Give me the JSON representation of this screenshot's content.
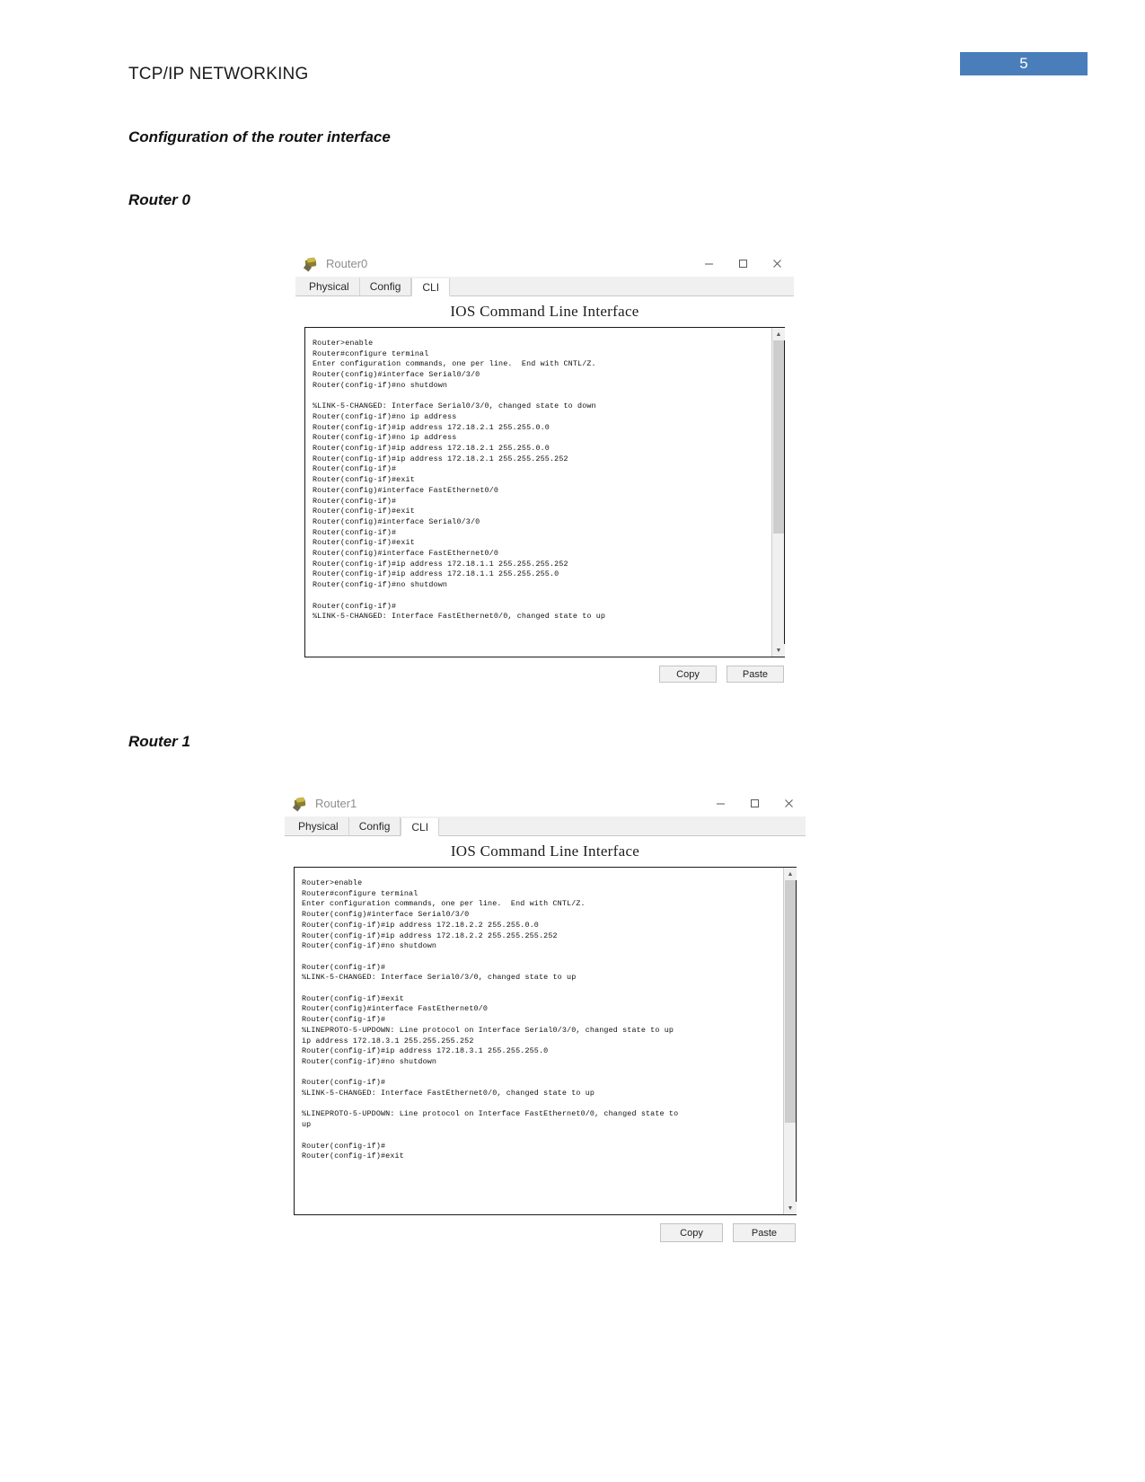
{
  "page": {
    "header_title": "TCP/IP NETWORKING",
    "page_number": "5",
    "badge_color": "#4A7EBB",
    "section_title": "Configuration of the router interface",
    "router0_label": "Router 0",
    "router1_label": "Router 1"
  },
  "window0": {
    "title": "Router0",
    "icon": "router-icon",
    "controls": {
      "minimize": "minimize-icon",
      "maximize": "maximize-icon",
      "close": "close-icon"
    },
    "tabs": [
      {
        "label": "Physical",
        "active": false
      },
      {
        "label": "Config",
        "active": false
      },
      {
        "label": "CLI",
        "active": true
      }
    ],
    "cli_heading": "IOS Command Line Interface",
    "terminal_text": "Router>enable\nRouter#configure terminal\nEnter configuration commands, one per line.  End with CNTL/Z.\nRouter(config)#interface Serial0/3/0\nRouter(config-if)#no shutdown\n\n%LINK-5-CHANGED: Interface Serial0/3/0, changed state to down\nRouter(config-if)#no ip address\nRouter(config-if)#ip address 172.18.2.1 255.255.0.0\nRouter(config-if)#no ip address\nRouter(config-if)#ip address 172.18.2.1 255.255.0.0\nRouter(config-if)#ip address 172.18.2.1 255.255.255.252\nRouter(config-if)#\nRouter(config-if)#exit\nRouter(config)#interface FastEthernet0/0\nRouter(config-if)#\nRouter(config-if)#exit\nRouter(config)#interface Serial0/3/0\nRouter(config-if)#\nRouter(config-if)#exit\nRouter(config)#interface FastEthernet0/0\nRouter(config-if)#ip address 172.18.1.1 255.255.255.252\nRouter(config-if)#ip address 172.18.1.1 255.255.255.0\nRouter(config-if)#no shutdown\n\nRouter(config-if)#\n%LINK-5-CHANGED: Interface FastEthernet0/0, changed state to up",
    "buttons": {
      "copy": "Copy",
      "paste": "Paste"
    },
    "scrollbar": {
      "up_arrow": "chevron-up-icon",
      "down_arrow": "chevron-down-icon"
    }
  },
  "window1": {
    "title": "Router1",
    "icon": "router-icon",
    "controls": {
      "minimize": "minimize-icon",
      "maximize": "maximize-icon",
      "close": "close-icon"
    },
    "tabs": [
      {
        "label": "Physical",
        "active": false
      },
      {
        "label": "Config",
        "active": false
      },
      {
        "label": "CLI",
        "active": true
      }
    ],
    "cli_heading": "IOS Command Line Interface",
    "terminal_text": "Router>enable\nRouter#configure terminal\nEnter configuration commands, one per line.  End with CNTL/Z.\nRouter(config)#interface Serial0/3/0\nRouter(config-if)#ip address 172.18.2.2 255.255.0.0\nRouter(config-if)#ip address 172.18.2.2 255.255.255.252\nRouter(config-if)#no shutdown\n\nRouter(config-if)#\n%LINK-5-CHANGED: Interface Serial0/3/0, changed state to up\n\nRouter(config-if)#exit\nRouter(config)#interface FastEthernet0/0\nRouter(config-if)#\n%LINEPROTO-5-UPDOWN: Line protocol on Interface Serial0/3/0, changed state to up\nip address 172.18.3.1 255.255.255.252\nRouter(config-if)#ip address 172.18.3.1 255.255.255.0\nRouter(config-if)#no shutdown\n\nRouter(config-if)#\n%LINK-5-CHANGED: Interface FastEthernet0/0, changed state to up\n\n%LINEPROTO-5-UPDOWN: Line protocol on Interface FastEthernet0/0, changed state to\nup\n\nRouter(config-if)#\nRouter(config-if)#exit",
    "buttons": {
      "copy": "Copy",
      "paste": "Paste"
    },
    "scrollbar": {
      "up_arrow": "chevron-up-icon",
      "down_arrow": "chevron-down-icon"
    }
  }
}
